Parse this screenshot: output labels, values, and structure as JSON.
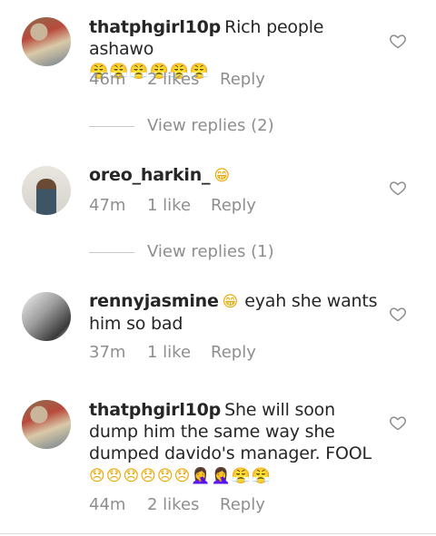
{
  "comments": [
    {
      "username": "thatphgirl10p",
      "text": "Rich people ashawo",
      "emoji": "😤😤😤😤😤😤",
      "time": "46m",
      "likes": "2 likes",
      "reply": "Reply",
      "view_replies": "View replies (2)"
    },
    {
      "username": "oreo_harkin_",
      "text": "",
      "emoji": "😁",
      "time": "47m",
      "likes": "1 like",
      "reply": "Reply",
      "view_replies": "View replies (1)"
    },
    {
      "username": "rennyjasmine",
      "text_before": "",
      "emoji": "😁",
      "text": "eyah she wants him so bad",
      "time": "37m",
      "likes": "1 like",
      "reply": "Reply"
    },
    {
      "username": "thatphgirl10p",
      "text": "She will soon dump him the same way she dumped davido's manager. FOOL",
      "emoji": "😞😞😞😞😞😞🤦‍♀️🤦‍♀️😤😤",
      "time": "44m",
      "likes": "2 likes",
      "reply": "Reply"
    }
  ],
  "icons": {
    "like": "heart-outline-icon"
  },
  "colors": {
    "text": "#262626",
    "muted": "#8e8e8e"
  }
}
